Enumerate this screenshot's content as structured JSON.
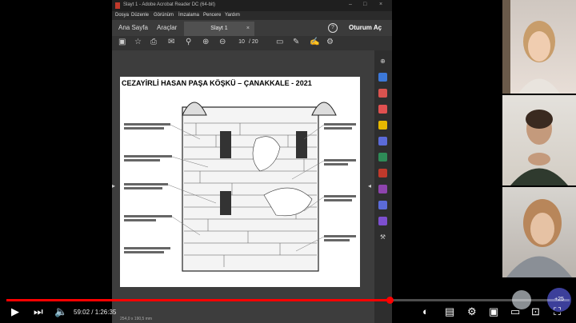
{
  "acrobat": {
    "title": "Slayt 1 - Adobe Acrobat Reader DC (64-bit)",
    "menu": [
      "Dosya",
      "Düzenle",
      "Görünüm",
      "İmzalama",
      "Pencere",
      "Yardım"
    ],
    "tabs": [
      "Ana Sayfa",
      "Araçlar"
    ],
    "doc_tab": "Slayt 1",
    "doc_tab_close": "×",
    "login": "Oturum Aç",
    "help_icon": "?",
    "page_current": "10",
    "page_sep": "/",
    "page_total": "20",
    "page_title": "CEZAYİRLİ HASAN PAŞA KÖŞKÜ – ÇANAKKALE - 2021",
    "page_size": "254,0 x 190,5 mm"
  },
  "video": {
    "time": "59:02 / 1:26:35",
    "progress": 0.68,
    "extra_participants": "+25"
  },
  "colors": {
    "accent": "#ff0000",
    "panel_dark": "#2a2a2a"
  }
}
